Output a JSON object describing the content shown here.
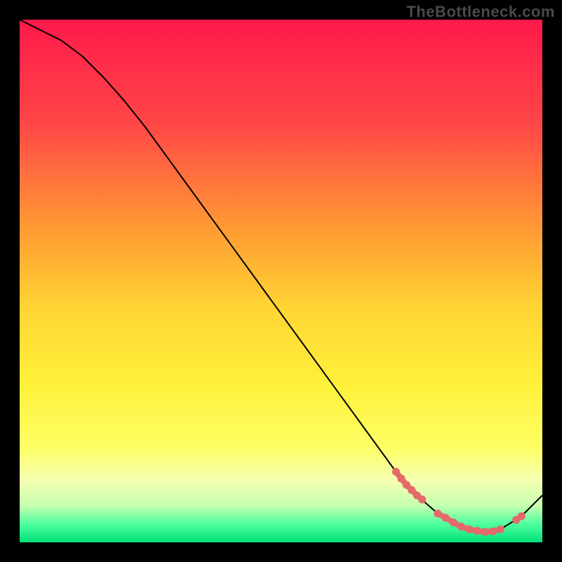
{
  "watermark": "TheBottleneck.com",
  "chart_data": {
    "type": "line",
    "title": "",
    "xlabel": "",
    "ylabel": "",
    "xlim": [
      0,
      100
    ],
    "ylim": [
      0,
      100
    ],
    "grid": false,
    "legend": false,
    "background_gradient_stops": [
      {
        "offset": 0.0,
        "color": "#ff1a4b"
      },
      {
        "offset": 0.2,
        "color": "#ff4747"
      },
      {
        "offset": 0.4,
        "color": "#ff9b33"
      },
      {
        "offset": 0.55,
        "color": "#ffd433"
      },
      {
        "offset": 0.7,
        "color": "#fff13a"
      },
      {
        "offset": 0.82,
        "color": "#fdff66"
      },
      {
        "offset": 0.88,
        "color": "#f6ffb0"
      },
      {
        "offset": 0.93,
        "color": "#c6ffb0"
      },
      {
        "offset": 0.965,
        "color": "#4dff9e"
      },
      {
        "offset": 1.0,
        "color": "#00e07a"
      }
    ],
    "series": [
      {
        "name": "bottleneck-curve",
        "stroke": "#000000",
        "x": [
          0,
          4,
          8,
          12,
          16,
          20,
          24,
          28,
          32,
          36,
          40,
          44,
          48,
          52,
          56,
          60,
          64,
          68,
          72,
          76,
          80,
          84,
          88,
          92,
          96,
          100
        ],
        "y": [
          100,
          98,
          96,
          93,
          89,
          84.5,
          79.5,
          74,
          68.5,
          63,
          57.5,
          52,
          46.5,
          41,
          35.5,
          30,
          24.5,
          19,
          13.5,
          9,
          5.5,
          3,
          2,
          2.5,
          5,
          9
        ]
      },
      {
        "name": "highlight-markers",
        "marker_color": "#e46a6a",
        "segments": [
          {
            "x": [
              72,
              73,
              74,
              75,
              76,
              77
            ],
            "y": [
              13.5,
              12.2,
              11.0,
              10.0,
              9.0,
              8.2
            ]
          },
          {
            "x": [
              80,
              81.5,
              83,
              84.5,
              86,
              87.5,
              89,
              90.5,
              92
            ],
            "y": [
              5.5,
              4.7,
              3.8,
              3.0,
              2.5,
              2.2,
              2.0,
              2.1,
              2.5
            ]
          },
          {
            "x": [
              95,
              96
            ],
            "y": [
              4.3,
              5.0
            ]
          }
        ]
      }
    ]
  }
}
